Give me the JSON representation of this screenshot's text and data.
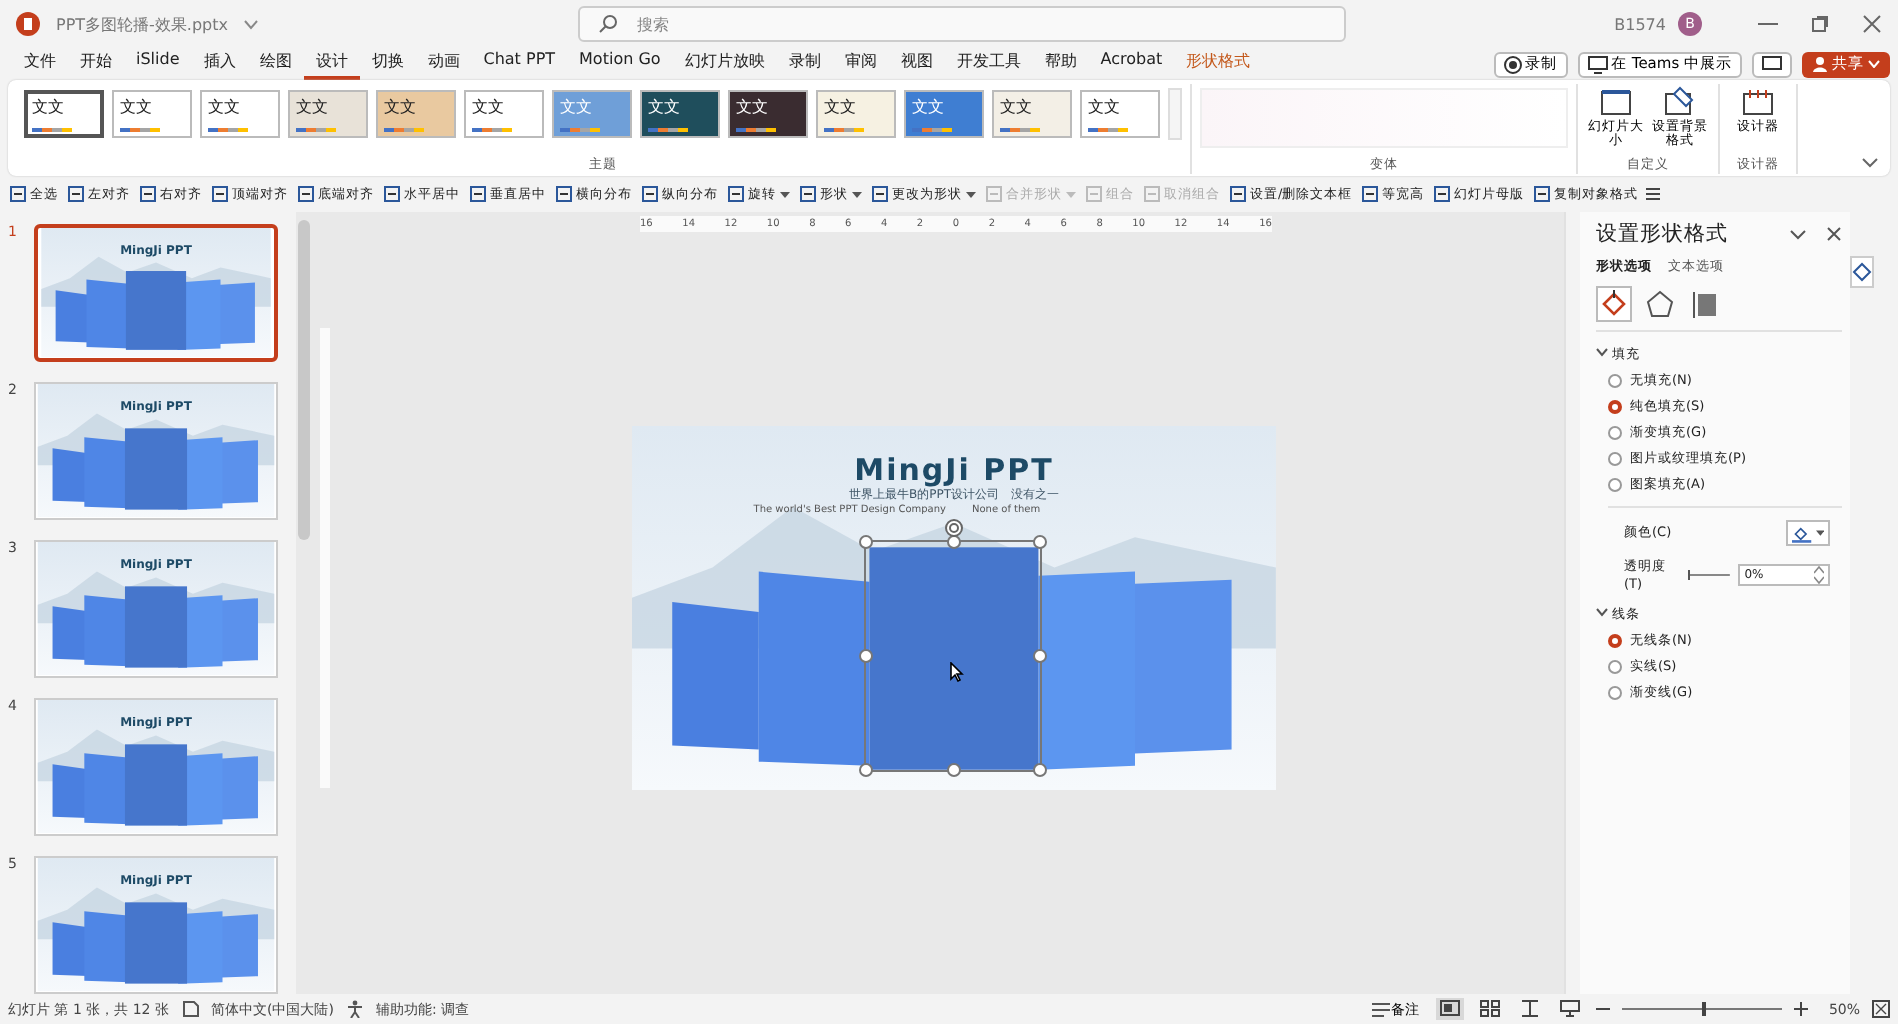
{
  "window": {
    "file_name": "PPT多图轮播-效果.pptx",
    "search": {
      "placeholder": "搜索"
    },
    "user": "B1574",
    "avatar_letter": "B"
  },
  "ribbon_tabs": [
    {
      "label": "文件",
      "selected": false,
      "contextual": false
    },
    {
      "label": "开始",
      "selected": false,
      "contextual": false
    },
    {
      "label": "iSlide",
      "selected": false,
      "contextual": false
    },
    {
      "label": "插入",
      "selected": false,
      "contextual": false
    },
    {
      "label": "绘图",
      "selected": false,
      "contextual": false
    },
    {
      "label": "设计",
      "selected": true,
      "contextual": false
    },
    {
      "label": "切换",
      "selected": false,
      "contextual": false
    },
    {
      "label": "动画",
      "selected": false,
      "contextual": false
    },
    {
      "label": "Chat PPT",
      "selected": false,
      "contextual": false
    },
    {
      "label": "Motion Go",
      "selected": false,
      "contextual": false
    },
    {
      "label": "幻灯片放映",
      "selected": false,
      "contextual": false
    },
    {
      "label": "录制",
      "selected": false,
      "contextual": false
    },
    {
      "label": "审阅",
      "selected": false,
      "contextual": false
    },
    {
      "label": "视图",
      "selected": false,
      "contextual": false
    },
    {
      "label": "开发工具",
      "selected": false,
      "contextual": false
    },
    {
      "label": "帮助",
      "selected": false,
      "contextual": false
    },
    {
      "label": "Acrobat",
      "selected": false,
      "contextual": false
    },
    {
      "label": "形状格式",
      "selected": false,
      "contextual": true
    }
  ],
  "top_buttons": {
    "record": "录制",
    "teams": "在 Teams 中展示",
    "share": "共享"
  },
  "ribbon": {
    "themes": [
      {
        "label": "文文",
        "color": "#ffffff",
        "selected": true
      },
      {
        "label": "文文",
        "color": "#ffffff",
        "selected": false
      },
      {
        "label": "文文",
        "color": "#ffffff",
        "selected": false
      },
      {
        "label": "文文",
        "color": "#e8e2d8",
        "selected": false
      },
      {
        "label": "文文",
        "color": "#e9c9a0",
        "selected": false
      },
      {
        "label": "文文",
        "color": "#ffffff",
        "selected": false
      },
      {
        "label": "文文",
        "color": "#6f9fd8",
        "selected": false
      },
      {
        "label": "文文",
        "color": "#1f4e5c",
        "selected": false
      },
      {
        "label": "文文",
        "color": "#3a2c30",
        "selected": false
      },
      {
        "label": "文文",
        "color": "#f6f1e2",
        "selected": false
      },
      {
        "label": "文文",
        "color": "#3f7ed2",
        "selected": false
      },
      {
        "label": "文文",
        "color": "#f3efe6",
        "selected": false
      },
      {
        "label": "文文",
        "color": "#ffffff",
        "selected": false
      }
    ],
    "groups": {
      "themes": "主题",
      "variants": "变体",
      "customize": "自定义",
      "designer": "设计器"
    },
    "buttons": [
      {
        "label": "幻灯片大小",
        "kind": "size"
      },
      {
        "label": "设置背景格式",
        "kind": "background"
      },
      {
        "label": "设计器",
        "kind": "designer"
      }
    ]
  },
  "toolbar": [
    {
      "label": "全选",
      "disabled": false,
      "dropdown": false
    },
    {
      "label": "左对齐",
      "disabled": false,
      "dropdown": false
    },
    {
      "label": "右对齐",
      "disabled": false,
      "dropdown": false
    },
    {
      "label": "顶端对齐",
      "disabled": false,
      "dropdown": false
    },
    {
      "label": "底端对齐",
      "disabled": false,
      "dropdown": false
    },
    {
      "label": "水平居中",
      "disabled": false,
      "dropdown": false
    },
    {
      "label": "垂直居中",
      "disabled": false,
      "dropdown": false
    },
    {
      "label": "横向分布",
      "disabled": false,
      "dropdown": false
    },
    {
      "label": "纵向分布",
      "disabled": false,
      "dropdown": false
    },
    {
      "label": "旋转",
      "disabled": false,
      "dropdown": true
    },
    {
      "label": "形状",
      "disabled": false,
      "dropdown": true
    },
    {
      "label": "更改为形状",
      "disabled": false,
      "dropdown": true
    },
    {
      "label": "合并形状",
      "disabled": true,
      "dropdown": true
    },
    {
      "label": "组合",
      "disabled": true,
      "dropdown": false
    },
    {
      "label": "取消组合",
      "disabled": true,
      "dropdown": false
    },
    {
      "label": "设置/删除文本框",
      "disabled": false,
      "dropdown": false
    },
    {
      "label": "等宽高",
      "disabled": false,
      "dropdown": false
    },
    {
      "label": "幻灯片母版",
      "disabled": false,
      "dropdown": false
    },
    {
      "label": "复制对象格式",
      "disabled": false,
      "dropdown": false
    }
  ],
  "thumbnails": [
    {
      "number": "1",
      "title": "MingJi PPT",
      "selected": true
    },
    {
      "number": "2",
      "title": "MingJi PPT",
      "selected": false
    },
    {
      "number": "3",
      "title": "MingJi PPT",
      "selected": false
    },
    {
      "number": "4",
      "title": "MingJi PPT",
      "selected": false
    },
    {
      "number": "5",
      "title": "MingJi PPT",
      "selected": false
    }
  ],
  "ruler": [
    "16",
    "14",
    "12",
    "10",
    "8",
    "6",
    "4",
    "2",
    "0",
    "2",
    "4",
    "6",
    "8",
    "10",
    "12",
    "14",
    "16"
  ],
  "slide": {
    "title": "MingJi PPT",
    "subtitle": "世界上最牛B的PPT设计公司　没有之一",
    "caption_left": "The world's Best PPT Design Company",
    "caption_right": "None of them"
  },
  "format_pane": {
    "title": "设置形状格式",
    "tabs": [
      {
        "label": "形状选项",
        "selected": true
      },
      {
        "label": "文本选项",
        "selected": false
      }
    ],
    "icon_tabs": [
      {
        "kind": "fill",
        "selected": true
      },
      {
        "kind": "effects",
        "selected": false
      },
      {
        "kind": "size",
        "selected": false
      }
    ],
    "sections": [
      {
        "label": "填充",
        "expanded": true,
        "options": [
          {
            "label": "无填充(N)",
            "selected": false
          },
          {
            "label": "纯色填充(S)",
            "selected": true
          },
          {
            "label": "渐变填充(G)",
            "selected": false
          },
          {
            "label": "图片或纹理填充(P)",
            "selected": false
          },
          {
            "label": "图案填充(A)",
            "selected": false
          }
        ],
        "color_label": "颜色(C)",
        "transparency_label": "透明度(T)",
        "transparency": {
          "level": 0
        },
        "transparency_value": "0%"
      },
      {
        "label": "线条",
        "expanded": true,
        "options": [
          {
            "label": "无线条(N)",
            "selected": true
          },
          {
            "label": "实线(S)",
            "selected": false
          },
          {
            "label": "渐变线(G)",
            "selected": false
          }
        ]
      }
    ]
  },
  "status_bar": {
    "slide_count": "幻灯片 第 1 张，共 12 张",
    "language": "简体中文(中国大陆)",
    "accessibility": "辅助功能: 调查",
    "notes": "备注",
    "views": [
      {
        "kind": "normal",
        "selected": true
      },
      {
        "kind": "sorter",
        "selected": false
      },
      {
        "kind": "reading",
        "selected": false
      },
      {
        "kind": "slideshow",
        "selected": false
      }
    ],
    "zoom": {
      "level": 0.5
    },
    "zoom_value": "50%"
  }
}
